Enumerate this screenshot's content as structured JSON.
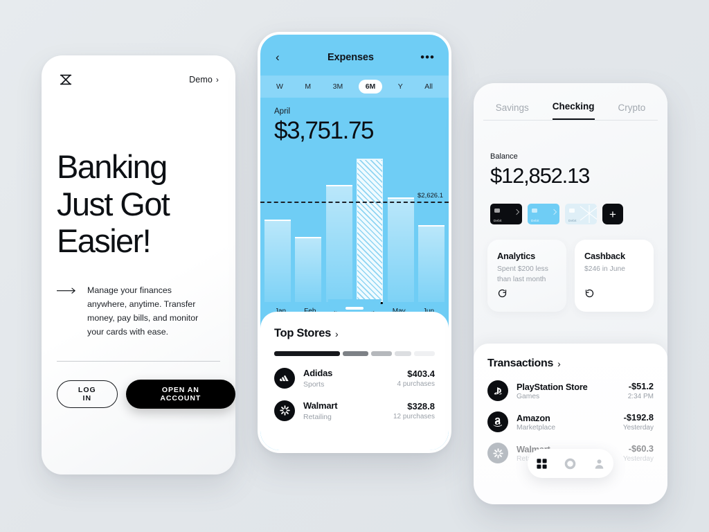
{
  "colors": {
    "page_bg": "#e4e8eb",
    "accent_blue": "#6fcdf5",
    "accent_blue_light": "#8ad6f8",
    "ink": "#0b0e13",
    "muted": "#9aa0a8"
  },
  "phone1": {
    "logo_icon": "hourglass-x-logo-icon",
    "demo_label": "Demo",
    "demo_chevron": "›",
    "headline_lines": [
      "Banking",
      "Just Got",
      "Easier!"
    ],
    "arrow_icon": "long-right-arrow-icon",
    "body_text": "Manage your finances anywhere, anytime. Transfer money, pay bills, and monitor your cards with ease.",
    "login_label": "LOG IN",
    "open_account_label": "OPEN AN ACCOUNT"
  },
  "phone2": {
    "back_icon": "‹",
    "title": "Expenses",
    "more_icon": "•••",
    "range_tabs": [
      {
        "label": "W",
        "active": false
      },
      {
        "label": "M",
        "active": false
      },
      {
        "label": "3M",
        "active": false
      },
      {
        "label": "6M",
        "active": true
      },
      {
        "label": "Y",
        "active": false
      },
      {
        "label": "All",
        "active": false
      }
    ],
    "month": "April",
    "amount": "$3,751.75",
    "average_label": "$2,626.1",
    "top_stores": {
      "title": "Top Stores",
      "chevron": "›",
      "segments": [
        {
          "width_pct": 44,
          "color": "#16181c"
        },
        {
          "width_pct": 17,
          "color": "#7d8186"
        },
        {
          "width_pct": 14,
          "color": "#b5b8bc"
        },
        {
          "width_pct": 11,
          "color": "#dcdee1"
        },
        {
          "width_pct": 14,
          "color": "#eff0f2"
        }
      ],
      "rows": [
        {
          "logo": "adidas-logo-icon",
          "name": "Adidas",
          "category": "Sports",
          "amount": "$403.4",
          "sub": "4 purchases"
        },
        {
          "logo": "walmart-logo-icon",
          "name": "Walmart",
          "category": "Retailing",
          "amount": "$328.8",
          "sub": "12 purchases"
        }
      ]
    }
  },
  "phone3": {
    "tabs": [
      {
        "label": "Savings",
        "active": false
      },
      {
        "label": "Checking",
        "active": true
      },
      {
        "label": "Crypto",
        "active": false
      }
    ],
    "balance_label": "Balance",
    "balance": "$12,852.13",
    "cards": [
      {
        "kind": "dark",
        "label": "Debit"
      },
      {
        "kind": "blue",
        "label": "Debit"
      },
      {
        "kind": "pale",
        "label": "Debit"
      }
    ],
    "add_card_icon": "+",
    "info_cards": [
      {
        "title": "Analytics",
        "subtitle": "Spent $200 less than last month",
        "icon": "refresh-circle-icon"
      },
      {
        "title": "Cashback",
        "subtitle": "$246 in June",
        "icon": "undo-arrow-icon"
      }
    ],
    "transactions": {
      "title": "Transactions",
      "chevron": "›",
      "rows": [
        {
          "logo": "playstation-logo-icon",
          "name": "PlayStation Store",
          "category": "Games",
          "amount": "-$51.2",
          "time": "2:34 PM",
          "dim": false
        },
        {
          "logo": "amazon-logo-icon",
          "name": "Amazon",
          "category": "Marketplace",
          "amount": "-$192.8",
          "time": "Yesterday",
          "dim": false
        },
        {
          "logo": "walmart-logo-icon",
          "name": "Walmart",
          "category": "Retailing",
          "amount": "-$60.3",
          "time": "Yesterday",
          "dim": true
        }
      ]
    },
    "bottom_nav": [
      {
        "icon": "grid-icon",
        "active": true
      },
      {
        "icon": "circle-icon",
        "active": false
      },
      {
        "icon": "person-icon",
        "active": false
      }
    ]
  },
  "chart_data": {
    "type": "bar",
    "title": "Expenses",
    "xlabel": "",
    "ylabel": "",
    "categories": [
      "Jan",
      "Feb",
      "Mar",
      "Apr",
      "May",
      "Jun"
    ],
    "values": [
      2160,
      1700,
      3060,
      3751.75,
      2740,
      2020
    ],
    "highlight_index": 3,
    "highlight_label": "April",
    "highlight_value": "$3,751.75",
    "average": 2626.1,
    "average_label": "$2,626.1",
    "ylim": [
      0,
      3900
    ],
    "grid": false,
    "legend": "none"
  }
}
